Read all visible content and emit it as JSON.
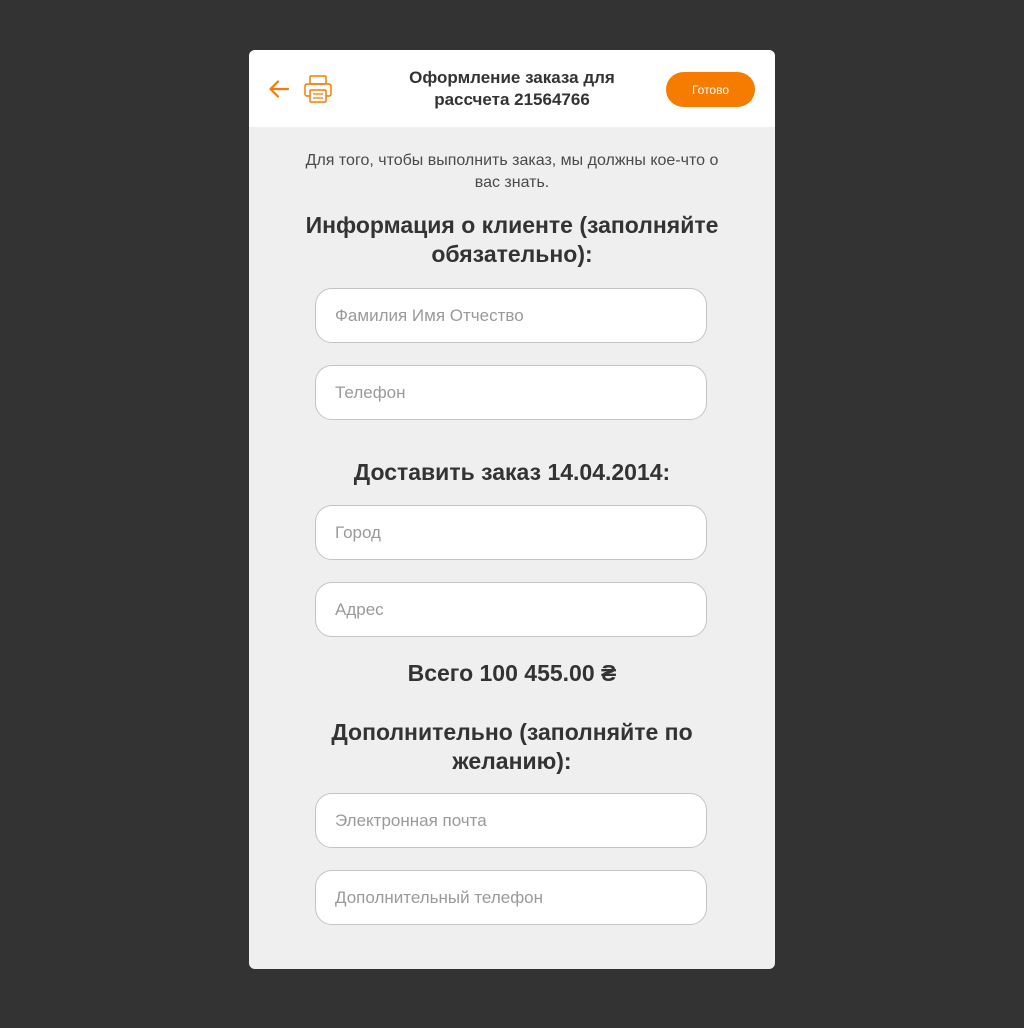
{
  "header": {
    "title": "Оформление заказа для рассчета 21564766",
    "done_label": "Готово"
  },
  "intro": "Для того, чтобы выполнить заказ, мы должны кое-что о вас знать.",
  "client_section": {
    "title": "Информация о клиенте (заполняйте обязательно):",
    "full_name_placeholder": "Фамилия Имя Отчество",
    "phone_placeholder": "Телефон"
  },
  "delivery_section": {
    "title": "Доставить заказ 14.04.2014:",
    "city_placeholder": "Город",
    "address_placeholder": "Адрес"
  },
  "total": "Всего 100 455.00 ₴",
  "optional_section": {
    "title": "Дополнительно (заполняйте по желанию):",
    "email_placeholder": "Электронная почта",
    "extra_phone_placeholder": "Дополнительный телефон"
  },
  "icons": {
    "back": "arrow-left-icon",
    "print": "printer-icon"
  },
  "colors": {
    "accent": "#f57c00",
    "background": "#333333",
    "card": "#efefef",
    "header": "#ffffff"
  }
}
